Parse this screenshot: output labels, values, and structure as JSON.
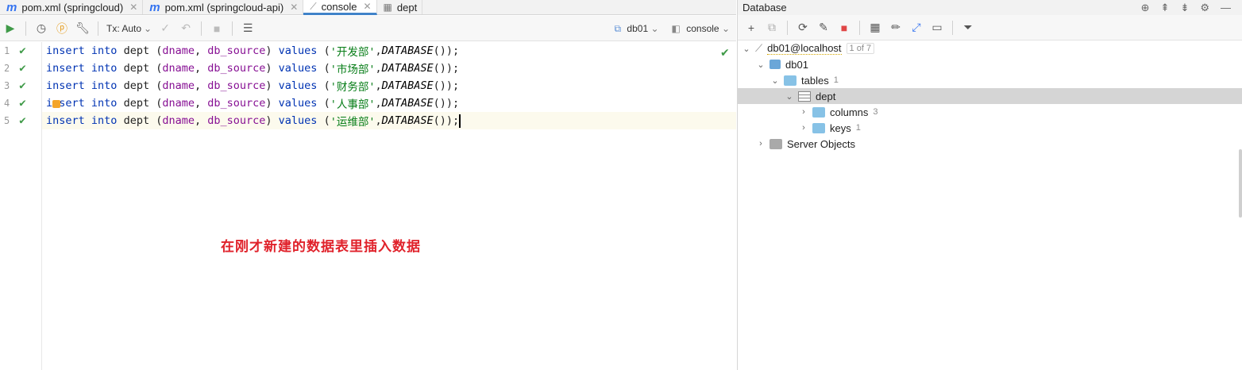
{
  "tabs": [
    {
      "icon": "m",
      "label": "pom.xml (springcloud)"
    },
    {
      "icon": "m",
      "label": "pom.xml (springcloud-api)"
    },
    {
      "icon": "console",
      "label": "console"
    },
    {
      "icon": "table",
      "label": "dept"
    }
  ],
  "toolbar": {
    "tx_label": "Tx: Auto",
    "datasource": "db01",
    "session": "console"
  },
  "editor": {
    "lines": [
      {
        "num": "1",
        "prefix": "insert",
        "mid": " into ",
        "table": "dept",
        "cols_open": " (",
        "c1": "dname",
        "comma": ", ",
        "c2": "db_source",
        "cols_close": ") ",
        "values_kw": "values",
        "open": " (",
        "str": "'开发部'",
        "sep": ",",
        "fn": "DATABASE",
        "close": "());"
      },
      {
        "num": "2",
        "prefix": "insert",
        "mid": " into ",
        "table": "dept",
        "cols_open": " (",
        "c1": "dname",
        "comma": ", ",
        "c2": "db_source",
        "cols_close": ") ",
        "values_kw": "values",
        "open": " (",
        "str": "'市场部'",
        "sep": ",",
        "fn": "DATABASE",
        "close": "());"
      },
      {
        "num": "3",
        "prefix": "insert",
        "mid": " into ",
        "table": "dept",
        "cols_open": " (",
        "c1": "dname",
        "comma": ", ",
        "c2": "db_source",
        "cols_close": ") ",
        "values_kw": "values",
        "open": " (",
        "str": "'财务部'",
        "sep": ",",
        "fn": "DATABASE",
        "close": "());"
      },
      {
        "num": "4",
        "prefix": "insert",
        "mid": " into ",
        "table": "dept",
        "cols_open": " (",
        "c1": "dname",
        "comma": ", ",
        "c2": "db_source",
        "cols_close": ") ",
        "values_kw": "values",
        "open": " (",
        "str": "'人事部'",
        "sep": ",",
        "fn": "DATABASE",
        "close": "());"
      },
      {
        "num": "5",
        "prefix": "insert",
        "mid": " into ",
        "table": "dept",
        "cols_open": " (",
        "c1": "dname",
        "comma": ", ",
        "c2": "db_source",
        "cols_close": ") ",
        "values_kw": "values",
        "open": " (",
        "str": "'运维部'",
        "sep": ",",
        "fn": "DATABASE",
        "close": "());"
      }
    ],
    "annotation": "在刚才新建的数据表里插入数据"
  },
  "database": {
    "title": "Database",
    "tree": {
      "connection": "db01@localhost",
      "connection_badge": "1 of 7",
      "schema": "db01",
      "tables_label": "tables",
      "tables_count": "1",
      "table": "dept",
      "columns_label": "columns",
      "columns_count": "3",
      "keys_label": "keys",
      "keys_count": "1",
      "server_objects": "Server Objects"
    }
  }
}
